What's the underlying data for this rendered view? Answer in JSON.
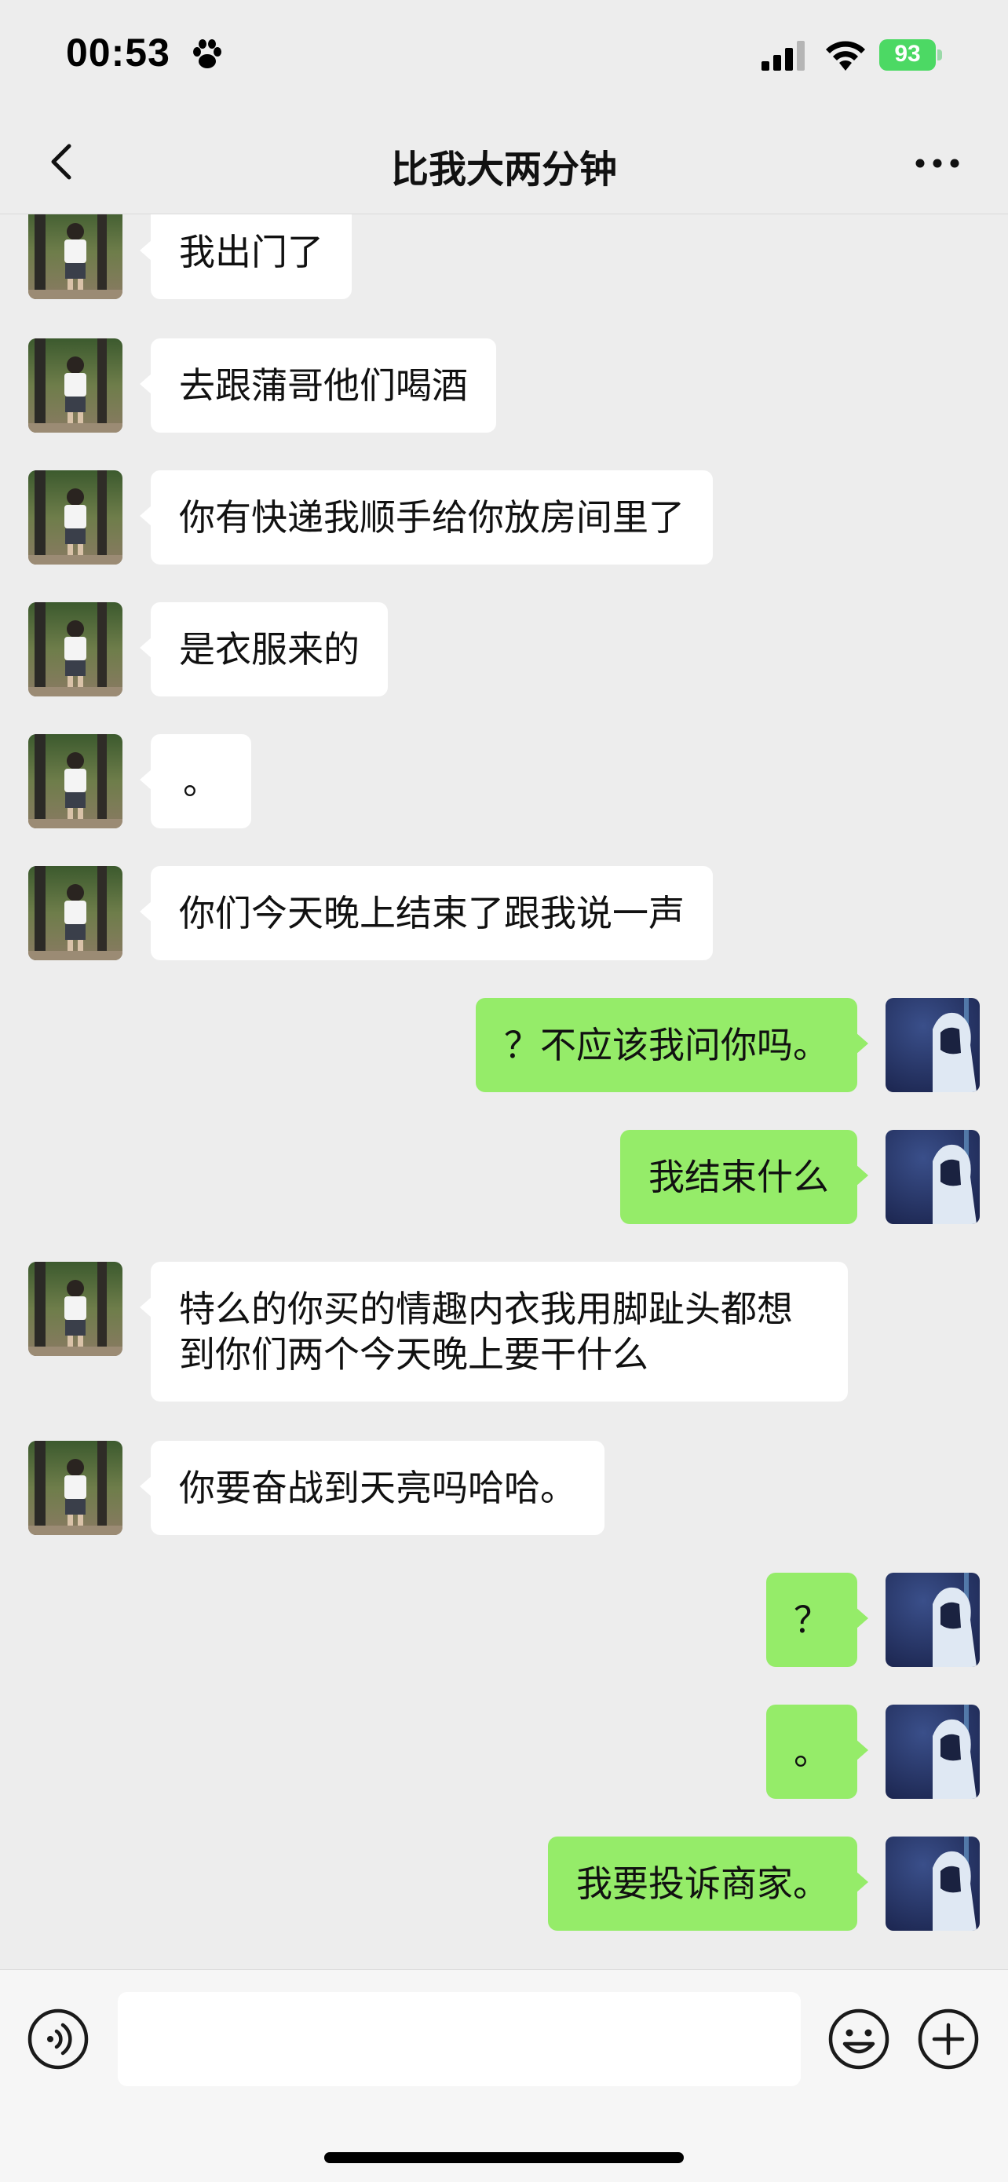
{
  "status_bar": {
    "time": "00:53",
    "battery": "93"
  },
  "chat": {
    "title": "比我大两分钟"
  },
  "messages": [
    {
      "side": "left",
      "text": "我出门了"
    },
    {
      "side": "left",
      "text": "去跟蒲哥他们喝酒"
    },
    {
      "side": "left",
      "text": "你有快递我顺手给你放房间里了"
    },
    {
      "side": "left",
      "text": "是衣服来的"
    },
    {
      "side": "left",
      "text": "。"
    },
    {
      "side": "left",
      "text": "你们今天晚上结束了跟我说一声"
    },
    {
      "side": "right",
      "text": "？不应该我问你吗。"
    },
    {
      "side": "right",
      "text": "我结束什么"
    },
    {
      "side": "left",
      "text": "特么的你买的情趣内衣我用脚趾头都想到你们两个今天晚上要干什么"
    },
    {
      "side": "left",
      "text": "你要奋战到天亮吗哈哈。"
    },
    {
      "side": "right",
      "text": "？"
    },
    {
      "side": "right",
      "text": "。"
    },
    {
      "side": "right",
      "text": "我要投诉商家。"
    }
  ],
  "icons": {
    "back": "chevron-left-icon",
    "more": "ellipsis-icon",
    "voice": "voice-icon",
    "emoji": "emoji-icon",
    "add": "plus-circle-icon"
  },
  "colors": {
    "background": "#ededed",
    "outgoing_bubble": "#95ec69",
    "incoming_bubble": "#ffffff",
    "battery": "#4cd964"
  }
}
